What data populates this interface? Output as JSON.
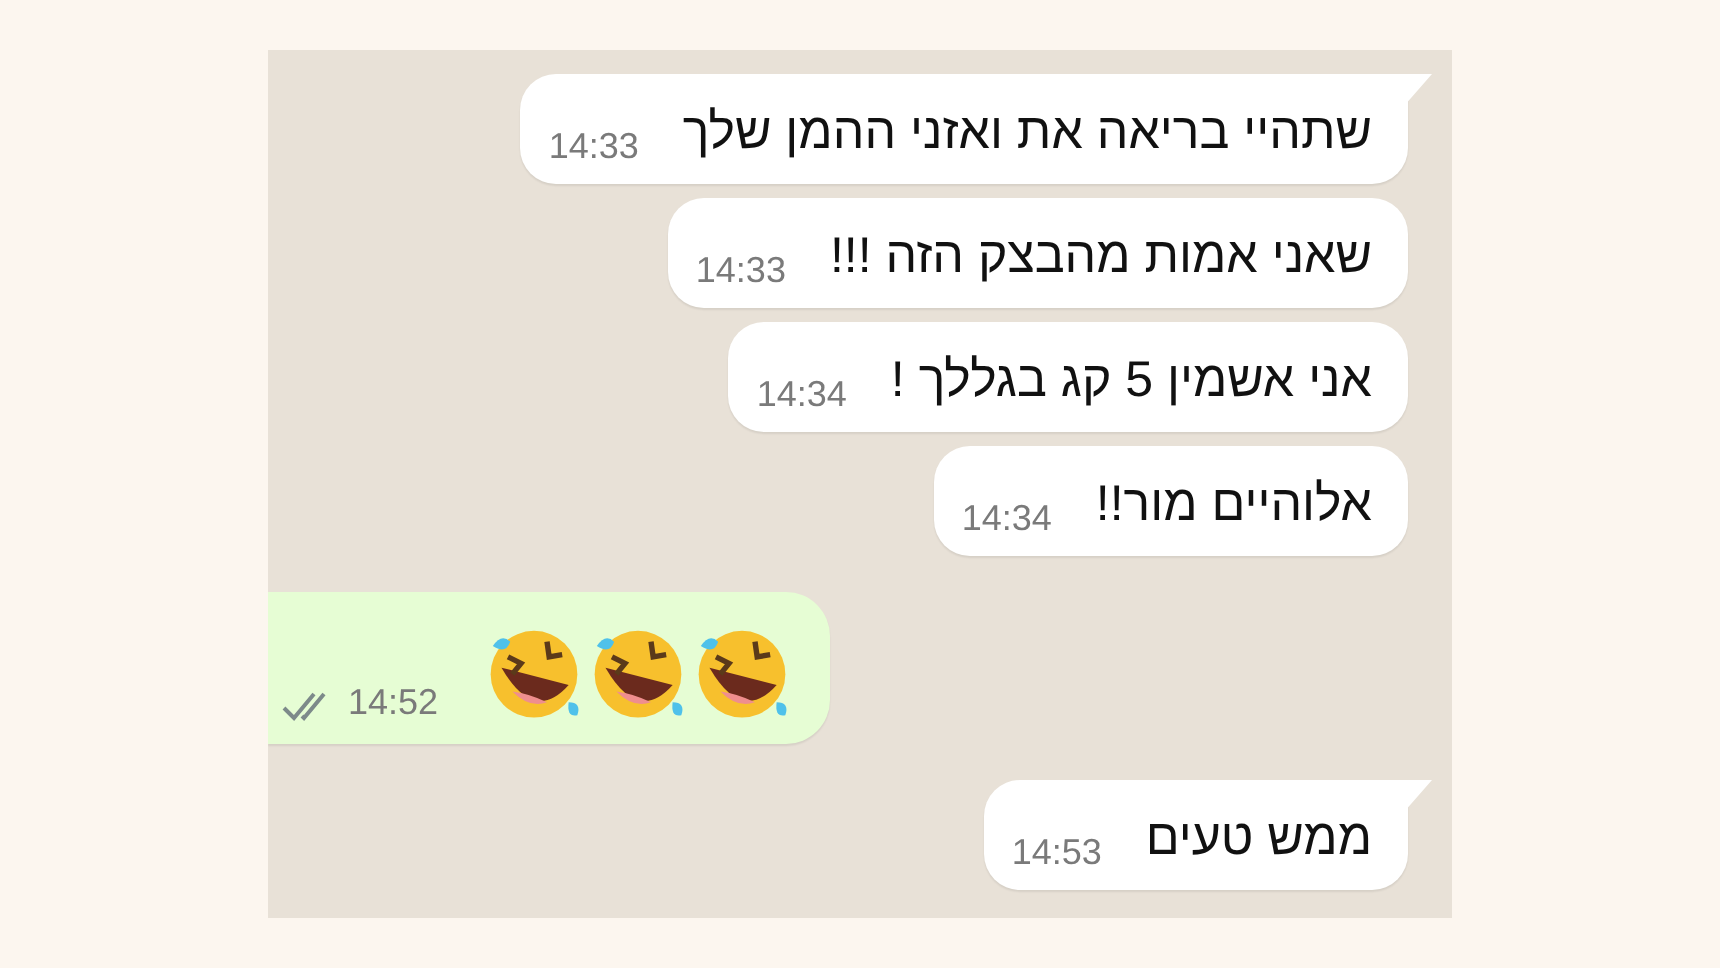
{
  "messages": [
    {
      "kind": "text",
      "outgoing": false,
      "tail": true,
      "text": "שתהיי בריאה את ואזני ההמן שלך",
      "time": "14:33"
    },
    {
      "kind": "text",
      "outgoing": false,
      "tail": false,
      "text": "שאני אמות מהבצק הזה !!!",
      "time": "14:33"
    },
    {
      "kind": "text",
      "outgoing": false,
      "tail": false,
      "text": "אני אשמין 5 קג בגללך !",
      "time": "14:34"
    },
    {
      "kind": "text",
      "outgoing": false,
      "tail": false,
      "text": "אלוהיים מור!!",
      "time": "14:34"
    },
    {
      "kind": "emoji",
      "outgoing": true,
      "tail": false,
      "time": "14:52",
      "read": false
    },
    {
      "kind": "text",
      "outgoing": false,
      "tail": true,
      "text": "ממש טעים",
      "time": "14:53"
    }
  ]
}
